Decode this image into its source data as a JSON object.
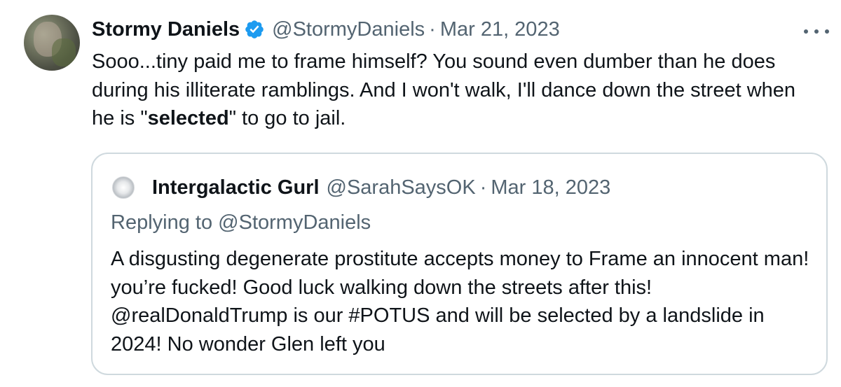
{
  "tweet": {
    "author_name": "Stormy Daniels",
    "handle": "@StormyDaniels",
    "separator": "·",
    "date": "Mar 21, 2023",
    "text_before_bold": "Sooo...tiny paid me to frame himself?  You sound even dumber than he does during his illiterate ramblings. And I won't walk, I'll dance down the street when he is \"",
    "text_bold": "selected",
    "text_after_bold": "\" to go to jail.",
    "verified_color": "#1d9bf0"
  },
  "quoted_tweet": {
    "author_name": "Intergalactic Gurl",
    "handle": "@SarahSaysOK",
    "separator": "·",
    "date": "Mar 18, 2023",
    "replying_label": "Replying to",
    "replying_to": "@StormyDaniels",
    "text": "A disgusting degenerate prostitute accepts money to Frame an innocent man! you’re fucked! Good luck walking down the streets after this! @realDonaldTrump is our #POTUS and will be selected by a landslide in 2024! No wonder Glen left you"
  },
  "icons": {
    "verified": "verified-badge-icon",
    "more": "more-options-icon"
  },
  "colors": {
    "text_primary": "#0f1419",
    "text_secondary": "#536471",
    "border": "#cfd9de"
  }
}
